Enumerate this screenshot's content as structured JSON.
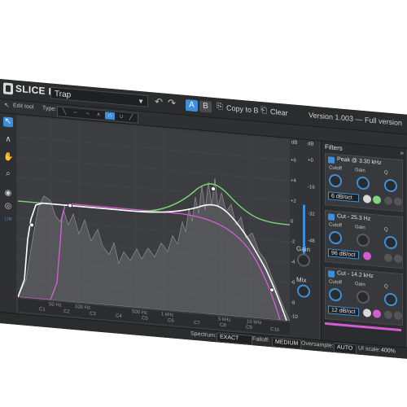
{
  "title_bar": {
    "app_name": "SLICE EQ",
    "preset": "Trap",
    "ab_a": "A",
    "ab_b": "B",
    "copy_to_b": "Copy to B",
    "clear": "Clear",
    "version": "Version 1.003 — Full version"
  },
  "toolbar": {
    "edit_tool": "Edit tool",
    "type_label": "Type:"
  },
  "left_tools": {
    "lr": "L/R"
  },
  "graph": {
    "db_header": "dB",
    "db_scale": [
      "+6",
      "+4",
      "+2",
      "0",
      "-2",
      "-4",
      "-6",
      "-8",
      "-10"
    ],
    "meter_scale": [
      "+0",
      "-16",
      "-32",
      "-48"
    ],
    "freq_labels": [
      "50 Hz",
      "100 Hz",
      "500 Hz",
      "1 kHz",
      "5 kHz",
      "10 kHz"
    ],
    "note_labels": [
      "C1",
      "C2",
      "C3",
      "C4",
      "C5",
      "C6",
      "C7",
      "C8",
      "C9",
      "C10"
    ],
    "curve_colors": {
      "total": "#ffffff",
      "peak": "#7fd67f",
      "cut": "#d25dd2",
      "spectrum": "#8a8a8a"
    }
  },
  "output": {
    "gain_label": "Gain",
    "mix_label": "Mix"
  },
  "filters_panel": {
    "header": "Filters",
    "cards": [
      {
        "title": "Peak @ 3.30 kHz",
        "knob_labels": [
          "Cutoff",
          "Gain",
          "Q"
        ],
        "slope": "6 dB/oct",
        "color": "#7fd67f"
      },
      {
        "title": "Cut - 25.3 Hz",
        "knob_labels": [
          "Cutoff",
          "Gain",
          "Q"
        ],
        "slope": "96 dB/oct",
        "color": "#d25dd2"
      },
      {
        "title": "Cut - 14.2 kHz",
        "knob_labels": [
          "Cutoff",
          "Gain",
          "Q"
        ],
        "slope": "12 dB/oct",
        "color": "#d25dd2"
      }
    ]
  },
  "status_bar": {
    "spectrum_label": "Spectrum:",
    "spectrum_value": "EXACT",
    "falloff_label": "Falloff:",
    "falloff_value": "MEDIUM",
    "oversample_label": "Oversample:",
    "oversample_value": "AUTO",
    "ui_scale_label": "UI scale:",
    "ui_scale_value": "400%"
  }
}
